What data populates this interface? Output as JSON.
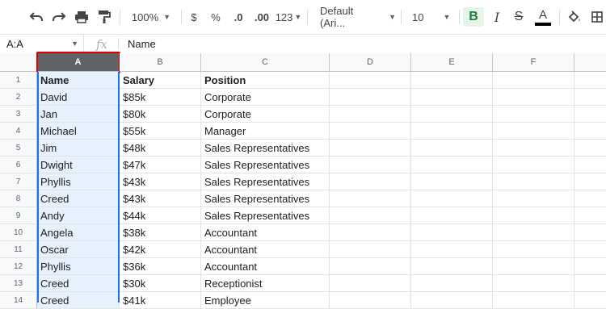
{
  "toolbar": {
    "zoom": "100%",
    "currency": "$",
    "percent": "%",
    "decrease_decimal": ".0",
    "increase_decimal": ".00",
    "more_formats": "123",
    "font": "Default (Ari...",
    "font_size": "10",
    "bold": "B",
    "italic": "I",
    "strike": "S",
    "text_color": "A",
    "text_color_value": "#000000"
  },
  "formula_bar": {
    "name_box": "A:A",
    "fx": "fx",
    "value": "Name"
  },
  "columns": [
    "A",
    "B",
    "C",
    "D",
    "E",
    "F"
  ],
  "selected_column": "A",
  "rows": [
    {
      "n": "1",
      "name": "Name",
      "salary": "Salary",
      "position": "Position"
    },
    {
      "n": "2",
      "name": "David",
      "salary": "$85k",
      "position": "Corporate"
    },
    {
      "n": "3",
      "name": "Jan",
      "salary": "$80k",
      "position": "Corporate"
    },
    {
      "n": "4",
      "name": "Michael",
      "salary": "$55k",
      "position": "Manager"
    },
    {
      "n": "5",
      "name": "Jim",
      "salary": "$48k",
      "position": "Sales Representatives"
    },
    {
      "n": "6",
      "name": "Dwight",
      "salary": "$47k",
      "position": "Sales Representatives"
    },
    {
      "n": "7",
      "name": "Phyllis",
      "salary": "$43k",
      "position": "Sales Representatives"
    },
    {
      "n": "8",
      "name": "Creed",
      "salary": "$43k",
      "position": "Sales Representatives"
    },
    {
      "n": "9",
      "name": "Andy",
      "salary": "$44k",
      "position": "Sales Representatives"
    },
    {
      "n": "10",
      "name": "Angela",
      "salary": "$38k",
      "position": "Accountant"
    },
    {
      "n": "11",
      "name": "Oscar",
      "salary": "$42k",
      "position": "Accountant"
    },
    {
      "n": "12",
      "name": "Phyllis",
      "salary": "$36k",
      "position": "Accountant"
    },
    {
      "n": "13",
      "name": "Creed",
      "salary": "$30k",
      "position": "Receptionist"
    },
    {
      "n": "14",
      "name": "Creed",
      "salary": "$41k",
      "position": "Employee"
    }
  ],
  "colors": {
    "selection": "#1a73e8",
    "selected_fill": "#e7f0fd",
    "highlight_box": "#e00000",
    "bold_active": "#188038"
  }
}
